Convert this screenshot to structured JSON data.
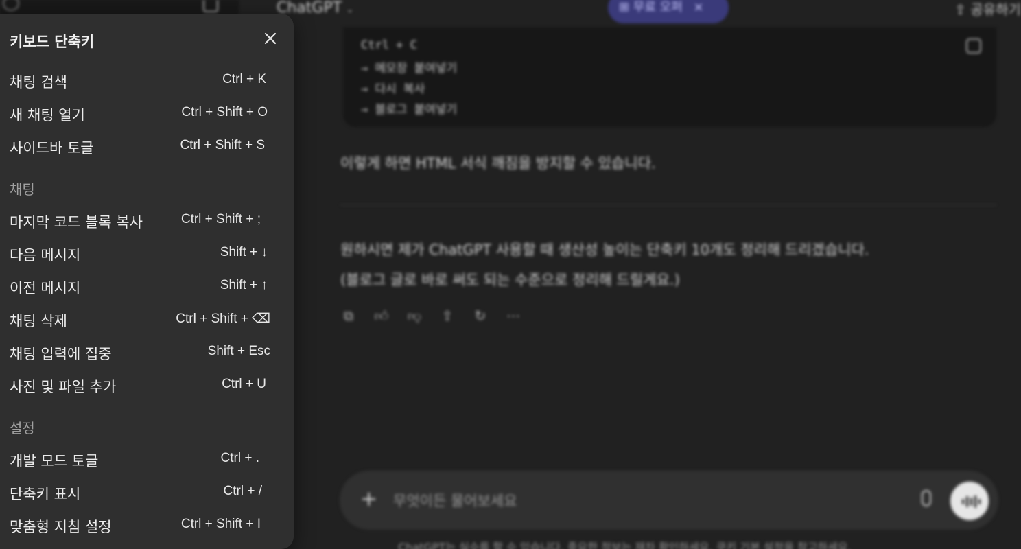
{
  "app": {
    "model_name": "ChatGPT",
    "offer_label": "무료 오퍼",
    "offer_close": "×",
    "share_label": "공유하기"
  },
  "conversation": {
    "code_lines": [
      "Ctrl + C",
      "→ 메모장 붙여넣기",
      "→ 다시 복사",
      "→ 블로그 붙여넣기"
    ],
    "paragraph_1": "이렇게 하면 HTML 서식 깨짐을 방지할 수 있습니다.",
    "paragraph_2": "원하시면 제가 ChatGPT 사용할 때 생산성 높이는 단축키 10개도 정리해 드리겠습니다.",
    "paragraph_3": "(블로그 글로 바로 써도 되는 수준으로 정리해 드릴게요.)"
  },
  "composer": {
    "placeholder": "무엇이든 물어보세요",
    "disclaimer": "ChatGPT는 실수를 할 수 있습니다. 중요한 정보는 재차 확인하세요. 쿠키 기본 설정을 참고하세요."
  },
  "modal": {
    "title": "키보드 단축키",
    "sections": {
      "chat": "채팅",
      "settings": "설정"
    },
    "general": [
      {
        "label": "채팅 검색",
        "keys": "Ctrl + K"
      },
      {
        "label": "새 채팅 열기",
        "keys": "Ctrl + Shift + O"
      },
      {
        "label": "사이드바 토글",
        "keys": "Ctrl + Shift + S"
      }
    ],
    "chat": [
      {
        "label": "마지막 코드 블록 복사",
        "keys": "Ctrl + Shift + ;"
      },
      {
        "label": "다음 메시지",
        "keys": "Shift + ↓"
      },
      {
        "label": "이전 메시지",
        "keys": "Shift + ↑"
      },
      {
        "label": "채팅 삭제",
        "keys": "Ctrl + Shift + ⌫"
      },
      {
        "label": "채팅 입력에 집중",
        "keys": "Shift + Esc"
      },
      {
        "label": "사진 및 파일 추가",
        "keys": "Ctrl + U"
      }
    ],
    "settings": [
      {
        "label": "개발 모드 토글",
        "keys": "Ctrl + ."
      },
      {
        "label": "단축키 표시",
        "keys": "Ctrl + /"
      },
      {
        "label": "맞춤형 지침 설정",
        "keys": "Ctrl + Shift + I"
      }
    ]
  }
}
